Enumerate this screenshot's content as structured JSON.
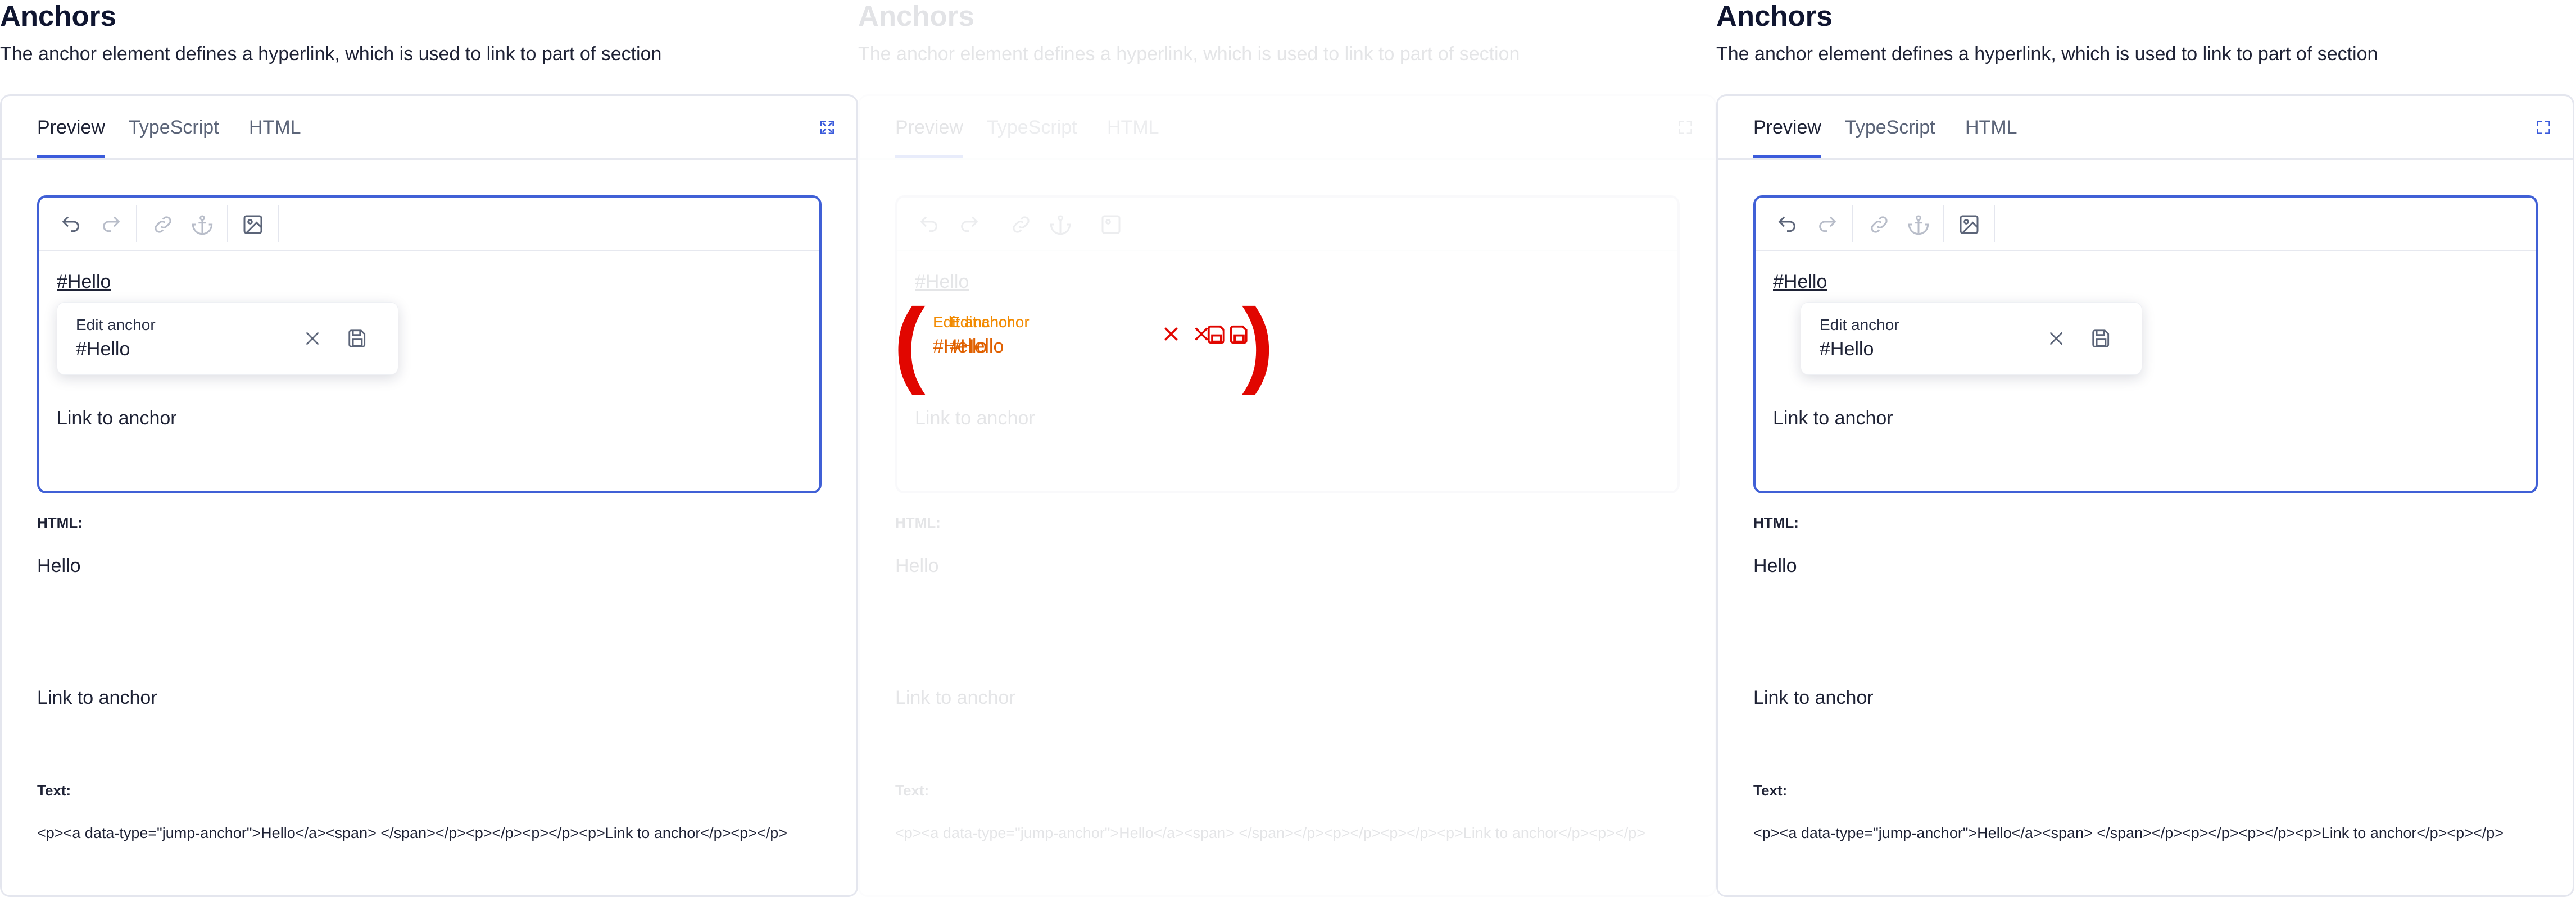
{
  "header": {
    "title": "Anchors",
    "subtitle": "The anchor element defines a hyperlink, which is used to link to part of section"
  },
  "tabs": [
    "Preview",
    "TypeScript",
    "HTML"
  ],
  "editor": {
    "anchor_link": "#Hello",
    "popup": {
      "label": "Edit anchor",
      "value": "#Hello"
    },
    "text": "Link to anchor"
  },
  "output": {
    "html_label": "HTML:",
    "html_lines": [
      "Hello",
      "Link to anchor"
    ],
    "text_label": "Text:",
    "code": "<p><a data-type=\"jump-anchor\">Hello</a><span> </span></p><p></p><p></p><p>Link to anchor</p><p></p>"
  },
  "colors": {
    "accent": "#3b5bdb",
    "border": "#e4e6ee",
    "text": "#1e2235",
    "marker_red": "#e10600",
    "marker_orange": "#f28a00"
  },
  "overlay": {
    "label_a": "Edit anchor",
    "label_b": "Edit anchor",
    "value_a": "#Hello",
    "value_b": "#Hello"
  }
}
